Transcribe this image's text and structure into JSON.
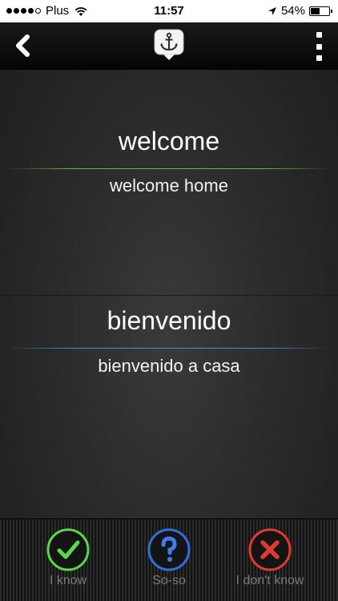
{
  "status_bar": {
    "carrier": "Plus",
    "time": "11:57",
    "battery_percent": "54%",
    "battery_level": 0.54,
    "signal_strength": 4,
    "signal_max": 5
  },
  "nav": {
    "back_icon": "chevron-left-icon",
    "logo_icon": "anchor-icon",
    "menu_icon": "vertical-dots-icon"
  },
  "card_front": {
    "term": "welcome",
    "example": "welcome home",
    "accent": "#5fbf3a"
  },
  "card_back": {
    "term": "bienvenido",
    "example": "bienvenido a casa",
    "accent": "#2e9be0"
  },
  "answers": [
    {
      "label": "I know",
      "icon": "check-icon",
      "color": "#5ad84a"
    },
    {
      "label": "So-so",
      "icon": "question-icon",
      "color": "#2f6fe0"
    },
    {
      "label": "I don't know",
      "icon": "cross-icon",
      "color": "#e03a2e"
    }
  ]
}
